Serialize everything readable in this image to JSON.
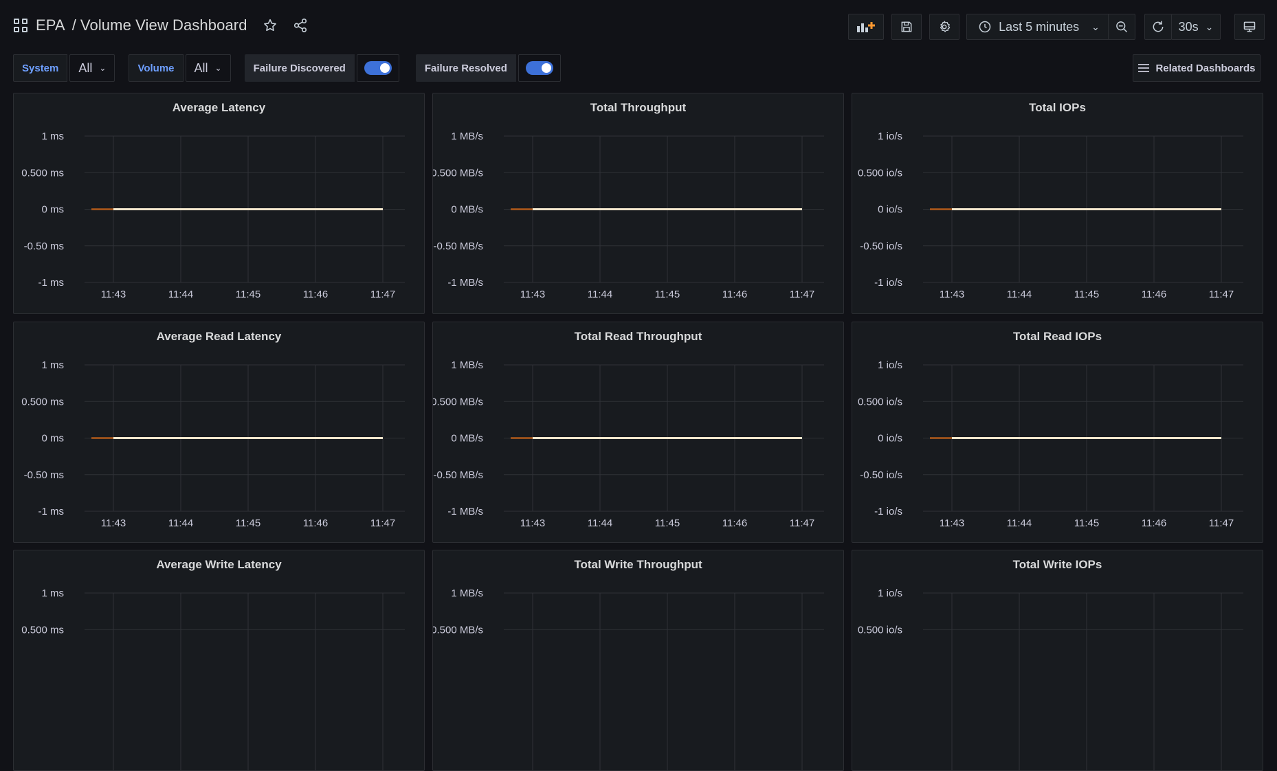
{
  "header": {
    "folder": "EPA",
    "separator": "/",
    "dashboard_title": "Volume View Dashboard",
    "time_range": "Last 5 minutes",
    "refresh_interval": "30s"
  },
  "variables": {
    "system_label": "System",
    "system_value": "All",
    "volume_label": "Volume",
    "volume_value": "All",
    "failure_discovered_label": "Failure Discovered",
    "failure_discovered_on": true,
    "failure_resolved_label": "Failure Resolved",
    "failure_resolved_on": true
  },
  "related_dashboards_label": "Related Dashboards",
  "colors": {
    "background": "#111217",
    "panel": "#181b1f",
    "accent_blue": "#3d71d9",
    "series_line": "#f2e6cc",
    "series_stub": "#b15b1a"
  },
  "panels": [
    {
      "title": "Average Latency",
      "yticks": [
        "1 ms",
        "0.500 ms",
        "0 ms",
        "-0.50 ms",
        "-1 ms"
      ],
      "xticks": [
        "11:43",
        "11:44",
        "11:45",
        "11:46",
        "11:47"
      ]
    },
    {
      "title": "Total Throughput",
      "yticks": [
        "1 MB/s",
        "0.500 MB/s",
        "0 MB/s",
        "-0.50 MB/s",
        "-1 MB/s"
      ],
      "xticks": [
        "11:43",
        "11:44",
        "11:45",
        "11:46",
        "11:47"
      ]
    },
    {
      "title": "Total IOPs",
      "yticks": [
        "1 io/s",
        "0.500 io/s",
        "0 io/s",
        "-0.50 io/s",
        "-1 io/s"
      ],
      "xticks": [
        "11:43",
        "11:44",
        "11:45",
        "11:46",
        "11:47"
      ]
    },
    {
      "title": "Average Read Latency",
      "yticks": [
        "1 ms",
        "0.500 ms",
        "0 ms",
        "-0.50 ms",
        "-1 ms"
      ],
      "xticks": [
        "11:43",
        "11:44",
        "11:45",
        "11:46",
        "11:47"
      ]
    },
    {
      "title": "Total Read Throughput",
      "yticks": [
        "1 MB/s",
        "0.500 MB/s",
        "0 MB/s",
        "-0.50 MB/s",
        "-1 MB/s"
      ],
      "xticks": [
        "11:43",
        "11:44",
        "11:45",
        "11:46",
        "11:47"
      ]
    },
    {
      "title": "Total Read IOPs",
      "yticks": [
        "1 io/s",
        "0.500 io/s",
        "0 io/s",
        "-0.50 io/s",
        "-1 io/s"
      ],
      "xticks": [
        "11:43",
        "11:44",
        "11:45",
        "11:46",
        "11:47"
      ]
    },
    {
      "title": "Average Write Latency",
      "yticks": [
        "1 ms",
        "0.500 ms"
      ],
      "xticks": []
    },
    {
      "title": "Total Write Throughput",
      "yticks": [
        "1 MB/s",
        "0.500 MB/s"
      ],
      "xticks": []
    },
    {
      "title": "Total Write IOPs",
      "yticks": [
        "1 io/s",
        "0.500 io/s"
      ],
      "xticks": []
    }
  ],
  "chart_data": [
    {
      "type": "line",
      "title": "Average Latency",
      "ylim": [
        -1,
        1
      ],
      "x": [
        "11:43",
        "11:44",
        "11:45",
        "11:46",
        "11:47"
      ],
      "series": [
        {
          "values": [
            0,
            0,
            0,
            0,
            0
          ]
        }
      ]
    },
    {
      "type": "line",
      "title": "Total Throughput",
      "ylim": [
        -1,
        1
      ],
      "x": [
        "11:43",
        "11:44",
        "11:45",
        "11:46",
        "11:47"
      ],
      "series": [
        {
          "values": [
            0,
            0,
            0,
            0,
            0
          ]
        }
      ]
    },
    {
      "type": "line",
      "title": "Total IOPs",
      "ylim": [
        -1,
        1
      ],
      "x": [
        "11:43",
        "11:44",
        "11:45",
        "11:46",
        "11:47"
      ],
      "series": [
        {
          "values": [
            0,
            0,
            0,
            0,
            0
          ]
        }
      ]
    },
    {
      "type": "line",
      "title": "Average Read Latency",
      "ylim": [
        -1,
        1
      ],
      "x": [
        "11:43",
        "11:44",
        "11:45",
        "11:46",
        "11:47"
      ],
      "series": [
        {
          "values": [
            0,
            0,
            0,
            0,
            0
          ]
        }
      ]
    },
    {
      "type": "line",
      "title": "Total Read Throughput",
      "ylim": [
        -1,
        1
      ],
      "x": [
        "11:43",
        "11:44",
        "11:45",
        "11:46",
        "11:47"
      ],
      "series": [
        {
          "values": [
            0,
            0,
            0,
            0,
            0
          ]
        }
      ]
    },
    {
      "type": "line",
      "title": "Total Read IOPs",
      "ylim": [
        -1,
        1
      ],
      "x": [
        "11:43",
        "11:44",
        "11:45",
        "11:46",
        "11:47"
      ],
      "series": [
        {
          "values": [
            0,
            0,
            0,
            0,
            0
          ]
        }
      ]
    }
  ]
}
